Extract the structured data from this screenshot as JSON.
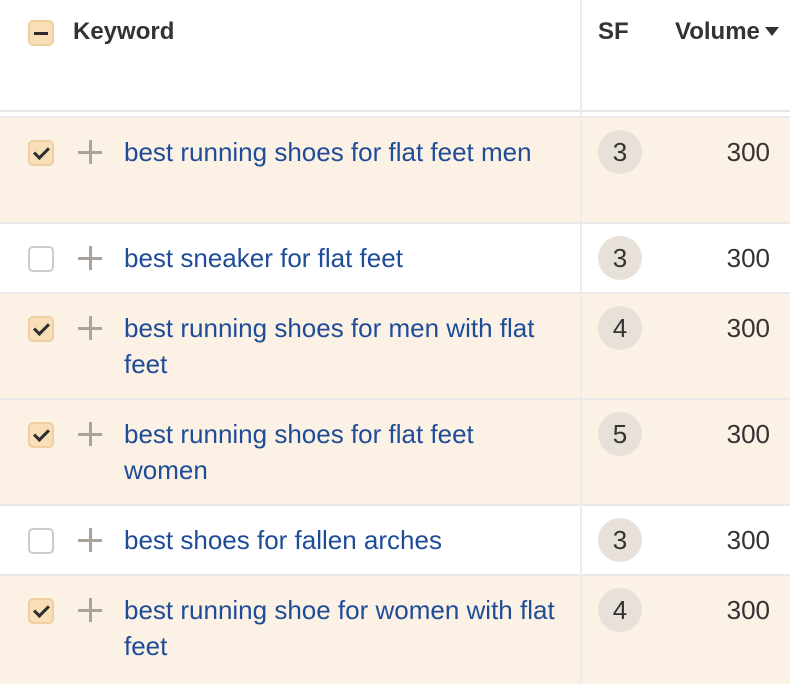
{
  "header": {
    "keyword": "Keyword",
    "sf": "SF",
    "volume": "Volume"
  },
  "rows": [
    {
      "keyword": "best running shoes for flat feet men",
      "sf": "3",
      "volume": "300",
      "checked": true
    },
    {
      "keyword": "best sneaker for flat feet",
      "sf": "3",
      "volume": "300",
      "checked": false
    },
    {
      "keyword": "best running shoes for men with flat feet",
      "sf": "4",
      "volume": "300",
      "checked": true
    },
    {
      "keyword": "best running shoes for flat feet women",
      "sf": "5",
      "volume": "300",
      "checked": true
    },
    {
      "keyword": "best shoes for fallen arches",
      "sf": "3",
      "volume": "300",
      "checked": false
    },
    {
      "keyword": "best running shoe for women with flat feet",
      "sf": "4",
      "volume": "300",
      "checked": true
    }
  ]
}
